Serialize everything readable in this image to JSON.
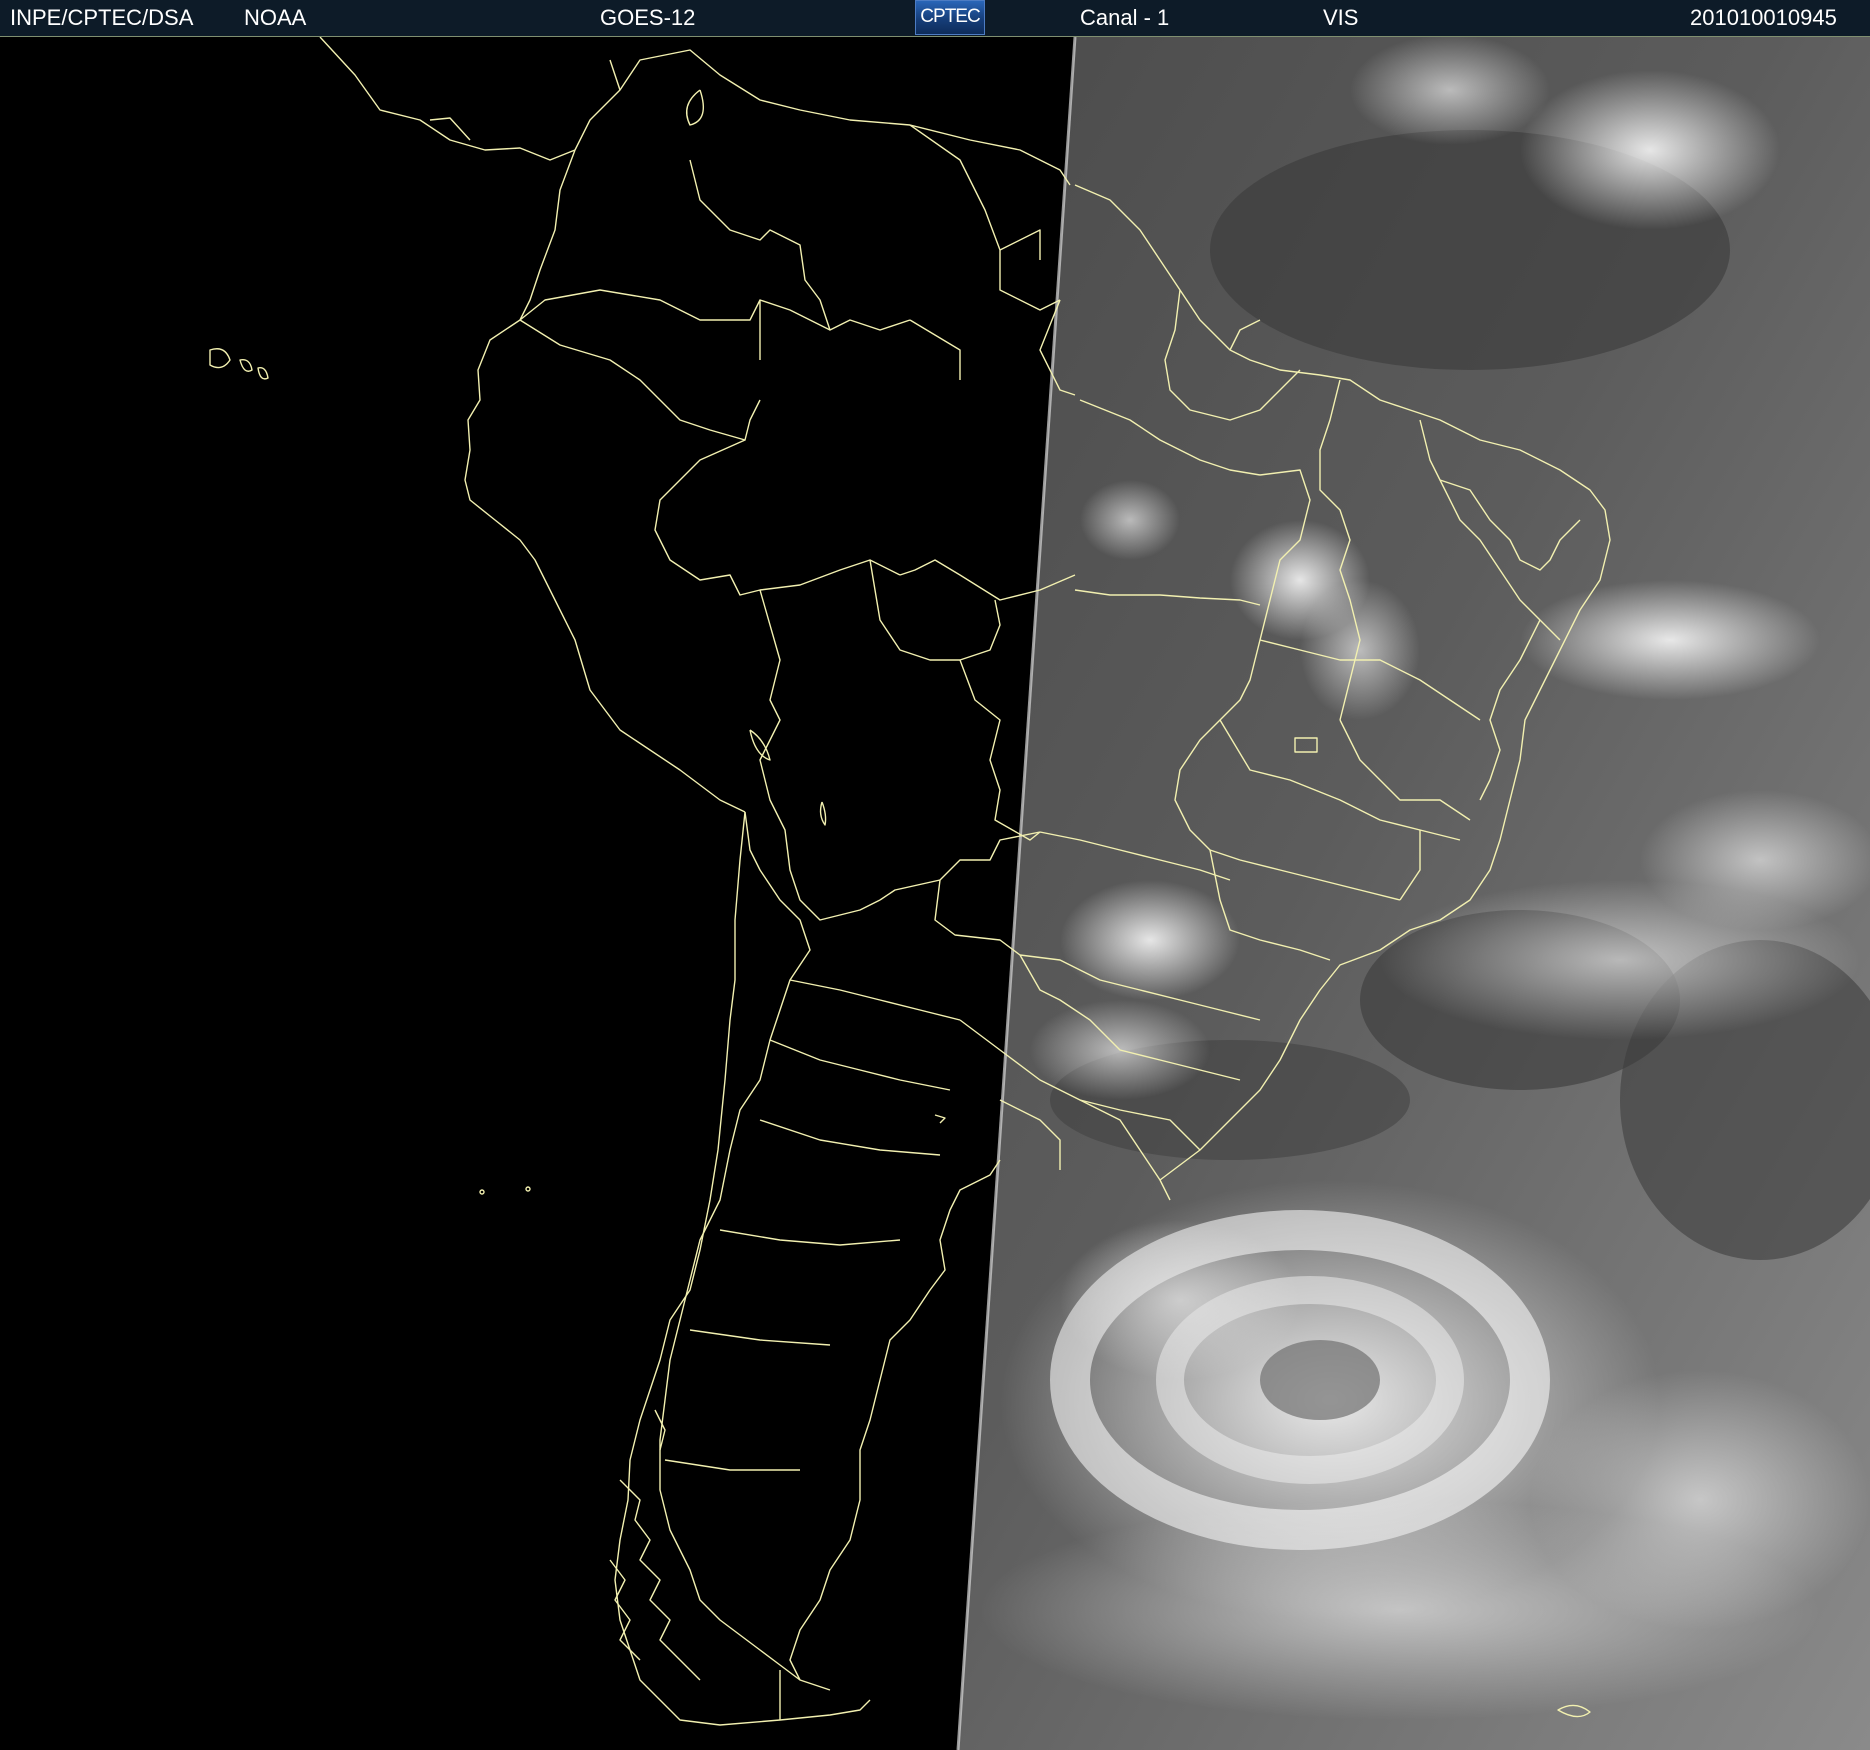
{
  "header": {
    "organization": "INPE/CPTEC/DSA",
    "agency": "NOAA",
    "satellite": "GOES-12",
    "logo_text": "CPTEC",
    "channel": "Canal - 1",
    "band": "VIS",
    "timestamp": "201010010945"
  },
  "colors": {
    "header_bg": "#0d1b28",
    "border_lines": "#f2f0b0",
    "night_side": "#000000"
  },
  "icons": {
    "logo": "cptec-logo"
  }
}
